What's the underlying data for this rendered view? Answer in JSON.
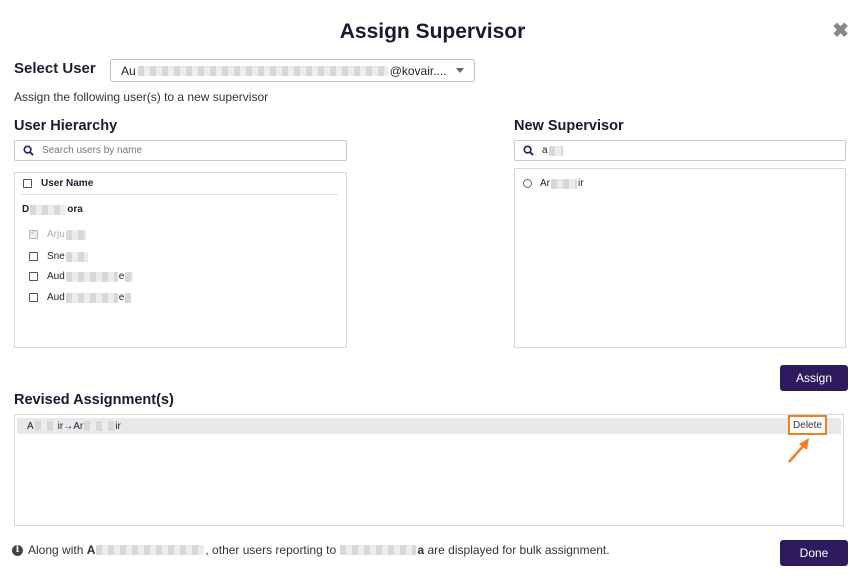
{
  "dialog": {
    "title": "Assign Supervisor",
    "close_glyph": "✖"
  },
  "select_user": {
    "label": "Select User",
    "value_prefix": "Au",
    "value_suffix": "@kovair...."
  },
  "assign_hint": "Assign the following user(s) to a new supervisor",
  "user_hierarchy": {
    "title": "User Hierarchy",
    "search_placeholder": "Search users by name",
    "column_header": "User Name",
    "root_user": {
      "prefix": "D",
      "suffix": "ora"
    },
    "users": [
      {
        "prefix": "Arju",
        "checked": true,
        "disabled": true
      },
      {
        "prefix": "Sne",
        "checked": false,
        "disabled": false
      },
      {
        "prefix": "Aud",
        "suffix": "e",
        "checked": false,
        "disabled": false
      },
      {
        "prefix": "Aud",
        "suffix": "e",
        "checked": false,
        "disabled": false
      }
    ]
  },
  "new_supervisor": {
    "title": "New Supervisor",
    "search_value": "a",
    "results": [
      {
        "prefix": "Ar",
        "suffix": "ir"
      }
    ]
  },
  "assign_button": "Assign",
  "revised": {
    "title": "Revised Assignment(s)",
    "rows": [
      {
        "from_prefix": "A",
        "from_suffix": "ir",
        "arrow": "→",
        "to_prefix": "Ar",
        "to_suffix": "ir"
      }
    ],
    "delete_label": "Delete"
  },
  "footer": {
    "note_prefix": "Along with",
    "user_initial": "A",
    "note_middle": ", other users reporting to",
    "supervisor_suffix": "a",
    "note_suffix": "are displayed for bulk assignment.",
    "done_label": "Done"
  },
  "colors": {
    "primary": "#2d1b5e",
    "highlight": "#f07f22"
  }
}
